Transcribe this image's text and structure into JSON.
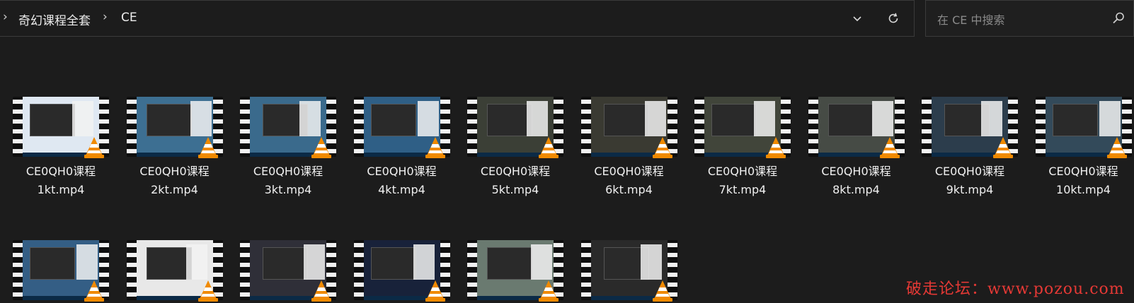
{
  "breadcrumb": {
    "items": [
      "奇幻课程全套",
      "CE"
    ]
  },
  "address_bar": {
    "dropdown_icon": "chevron-down-icon",
    "refresh_icon": "refresh-icon"
  },
  "search": {
    "placeholder": "在 CE 中搜索",
    "icon": "search-icon"
  },
  "files_row1": [
    {
      "name": "CE0QH0课程",
      "ext": "1kt.mp4"
    },
    {
      "name": "CE0QH0课程",
      "ext": "2kt.mp4"
    },
    {
      "name": "CE0QH0课程",
      "ext": "3kt.mp4"
    },
    {
      "name": "CE0QH0课程",
      "ext": "4kt.mp4"
    },
    {
      "name": "CE0QH0课程",
      "ext": "5kt.mp4"
    },
    {
      "name": "CE0QH0课程",
      "ext": "6kt.mp4"
    },
    {
      "name": "CE0QH0课程",
      "ext": "7kt.mp4"
    },
    {
      "name": "CE0QH0课程",
      "ext": "8kt.mp4"
    },
    {
      "name": "CE0QH0课程",
      "ext": "9kt.mp4"
    },
    {
      "name": "CE0QH0课程",
      "ext": "10kt.mp4"
    }
  ],
  "files_row2_count": 6,
  "watermark": "破走论坛：www.pozou.com",
  "colors": {
    "background": "#1c1c1c",
    "text": "#f0f0f0",
    "watermark": "#e53935",
    "vlc_orange": "#f08a00"
  }
}
